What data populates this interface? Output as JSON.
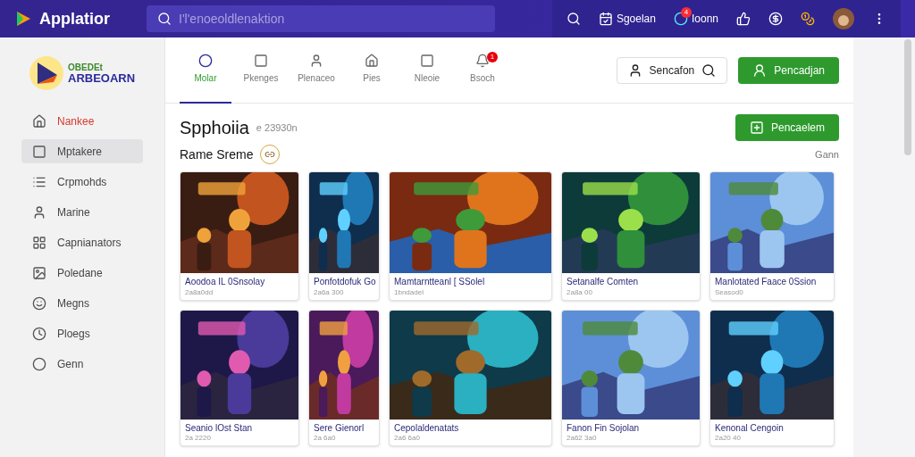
{
  "topbar": {
    "app_name": "Applatior",
    "search": {
      "placeholder": "I'l'enoeoldlenaktion"
    },
    "actions": [
      {
        "kind": "calendar",
        "label": "Sgoelan"
      },
      {
        "kind": "notify",
        "label": "Ioonn",
        "badge": "4"
      },
      {
        "kind": "thumb"
      },
      {
        "kind": "pay"
      },
      {
        "kind": "coin"
      },
      {
        "kind": "avatar"
      },
      {
        "kind": "more"
      }
    ]
  },
  "sidebar": {
    "logo": {
      "line1": "OBEDEt",
      "line2": "ARBEOARN"
    },
    "items": [
      {
        "label": "Nankee",
        "selected": false,
        "active": true
      },
      {
        "label": "Mptakere",
        "selected": true,
        "active": false
      },
      {
        "label": "Crpmohds",
        "selected": false,
        "active": false
      },
      {
        "label": "Marine",
        "selected": false,
        "active": false
      },
      {
        "label": "Capnianators",
        "selected": false,
        "active": false
      },
      {
        "label": "Poledane",
        "selected": false,
        "active": false
      },
      {
        "label": "Megns",
        "selected": false,
        "active": false
      },
      {
        "label": "Ploegs",
        "selected": false,
        "active": false
      },
      {
        "label": "Genn",
        "selected": false,
        "active": false
      }
    ]
  },
  "tabs": [
    {
      "label": "Molar",
      "selected": true
    },
    {
      "label": "Pkenges",
      "selected": false
    },
    {
      "label": "Plenaceo",
      "selected": false
    },
    {
      "label": "Pies",
      "selected": false
    },
    {
      "label": "Nleoie",
      "selected": false
    },
    {
      "label": "Bsoch",
      "selected": false,
      "badge": "1"
    }
  ],
  "header_buttons": [
    {
      "label": "Sencafon",
      "kind": "outline"
    },
    {
      "label": "Pencadjan",
      "kind": "primary"
    }
  ],
  "section": {
    "title": "Spphoiia",
    "subtitle": "e 23930n",
    "action": "Pencaelem",
    "subsection": "Rame Sreme",
    "link": "Gann"
  },
  "cards": [
    {
      "title": "Aoodoa IL 0Snsolay",
      "subtitle": "2a8a0dd"
    },
    {
      "title": "Ponfotdofuk Go",
      "subtitle": "2a6a 300"
    },
    {
      "title": "Mamtarntteanl [ SSolel",
      "subtitle": "1bndadel"
    },
    {
      "title": "Setanalfe Comten",
      "subtitle": "2a8a 00"
    },
    {
      "title": "Manlotated Faace 0Ssion",
      "subtitle": "Seasod0"
    },
    {
      "title": "Seanio lOst Stan",
      "subtitle": "2a 2220"
    },
    {
      "title": "Sere Gienorl",
      "subtitle": "2a 6a0"
    },
    {
      "title": "Cepolaldenatats",
      "subtitle": "2a6 6a0"
    },
    {
      "title": "Fanon Fin Sojolan",
      "subtitle": "2a62 3a0"
    },
    {
      "title": "Kenonal Cengoin",
      "subtitle": "2a20 40"
    }
  ]
}
